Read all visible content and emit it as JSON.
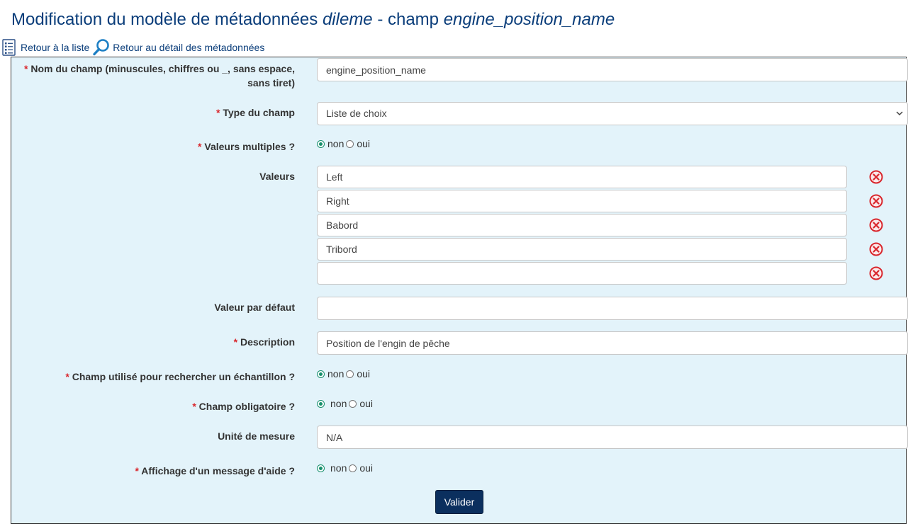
{
  "header": {
    "title_prefix": "Modification du modèle de métadonnées ",
    "model_name": "dileme",
    "title_middle": " - champ ",
    "field_name": "engine_position_name"
  },
  "nav": {
    "back_to_list": "Retour à la liste",
    "back_to_detail": "Retour au détail des métadonnées"
  },
  "form": {
    "required_mark": "*",
    "field_name": {
      "label_line1": "Nom du champ (minuscules, chiffres ou _, sans espace,",
      "label_line2": "sans tiret)",
      "value": "engine_position_name"
    },
    "field_type": {
      "label": "Type du champ",
      "value": "Liste de choix"
    },
    "multiple_values": {
      "label": "Valeurs multiples ?",
      "selected": "non",
      "options": [
        "non",
        "oui"
      ]
    },
    "values": {
      "label": "Valeurs",
      "items": [
        "Left",
        "Right",
        "Babord",
        "Tribord",
        ""
      ]
    },
    "default_value": {
      "label": "Valeur par défaut",
      "value": ""
    },
    "description": {
      "label": "Description",
      "value": "Position de l'engin de pêche"
    },
    "search_field": {
      "label": "Champ utilisé pour rechercher un échantillon ?",
      "selected": "non",
      "options": [
        "non",
        "oui"
      ]
    },
    "mandatory": {
      "label": "Champ obligatoire ?",
      "selected": "non",
      "options": [
        "non",
        "oui"
      ]
    },
    "unit": {
      "label": "Unité de mesure",
      "value": "N/A"
    },
    "help_message": {
      "label": "Affichage d'un message d'aide ?",
      "selected": "non",
      "options": [
        "non",
        "oui"
      ]
    },
    "submit_label": "Valider"
  },
  "colors": {
    "title": "#0a3d7a",
    "form_background": "#e3f3fa",
    "required": "#d9262c",
    "radio_checked": "#168f6c",
    "delete_icon": "#d9262c",
    "button": "#0b2f5e"
  }
}
